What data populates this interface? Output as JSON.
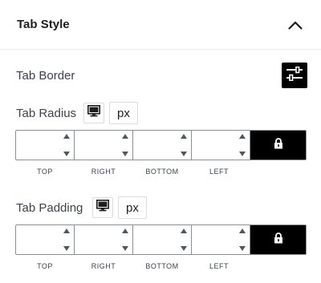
{
  "panel": {
    "title": "Tab Style",
    "toggle_icon": "chevron-up-icon"
  },
  "tab_border": {
    "label": "Tab Border",
    "settings_icon": "sliders-icon"
  },
  "tab_radius": {
    "label": "Tab Radius",
    "device_icon": "desktop-icon",
    "unit": "px",
    "fields": [
      {
        "key": "top",
        "value": "",
        "label": "TOP"
      },
      {
        "key": "right",
        "value": "",
        "label": "RIGHT"
      },
      {
        "key": "bottom",
        "value": "",
        "label": "BOTTOM"
      },
      {
        "key": "left",
        "value": "",
        "label": "LEFT"
      }
    ],
    "lock_icon": "lock-icon"
  },
  "tab_padding": {
    "label": "Tab Padding",
    "device_icon": "desktop-icon",
    "unit": "px",
    "fields": [
      {
        "key": "top",
        "value": "",
        "label": "TOP"
      },
      {
        "key": "right",
        "value": "",
        "label": "RIGHT"
      },
      {
        "key": "bottom",
        "value": "",
        "label": "BOTTOM"
      },
      {
        "key": "left",
        "value": "",
        "label": "LEFT"
      }
    ],
    "lock_icon": "lock-icon"
  },
  "colors": {
    "accent": "#000000",
    "border": "#8c8f94",
    "label": "#3c434a"
  }
}
